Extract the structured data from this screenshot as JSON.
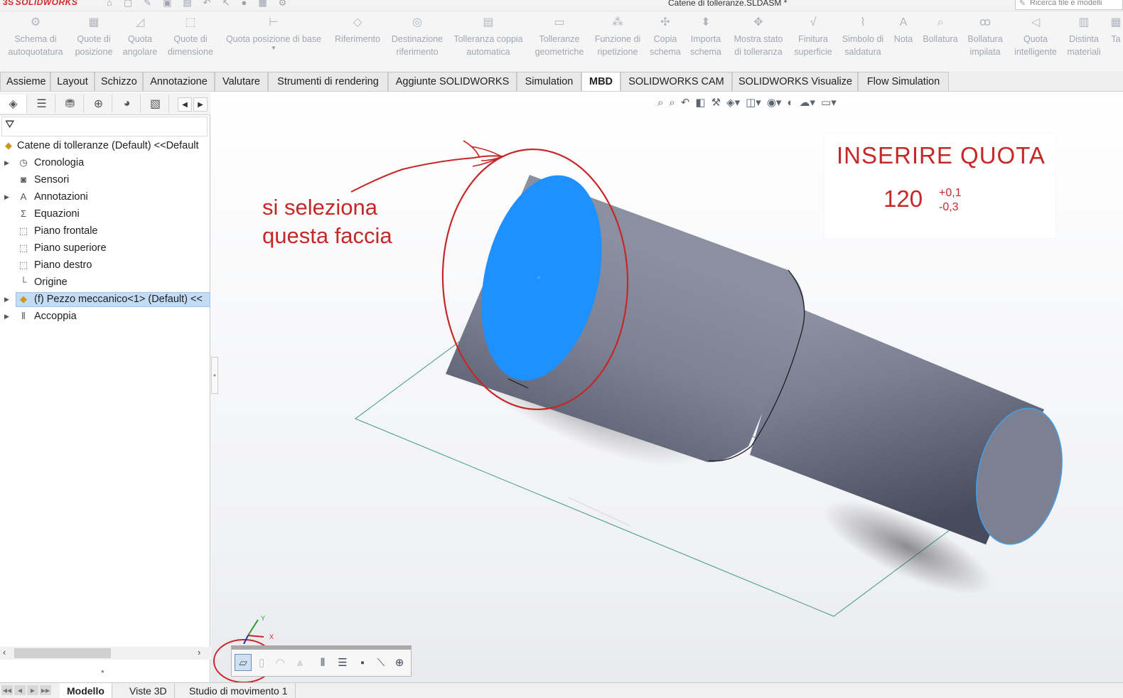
{
  "app": {
    "logo_text": "SOLIDWORKS",
    "document_title": "Catene di tolleranze.SLDASM *",
    "search_placeholder": "Ricerca file e modelli"
  },
  "ribbon": {
    "buttons": [
      {
        "line1": "Schema di",
        "line2": "autoquotatura",
        "icon": "autodimension-scheme-icon"
      },
      {
        "line1": "Quote di",
        "line2": "posizione",
        "icon": "location-dimension-icon"
      },
      {
        "line1": "Quota",
        "line2": "angolare",
        "icon": "angle-dimension-icon"
      },
      {
        "line1": "Quote di",
        "line2": "dimensione",
        "icon": "size-dimension-icon"
      },
      {
        "line1": "Quota posizione di base",
        "line2": "",
        "icon": "basic-location-dimension-icon"
      },
      {
        "line1": "Riferimento",
        "line2": "",
        "icon": "datum-icon"
      },
      {
        "line1": "Destinazione",
        "line2": "riferimento",
        "icon": "datum-target-icon"
      },
      {
        "line1": "Tolleranza coppia",
        "line2": "automatica",
        "icon": "auto-pair-tolerance-icon"
      },
      {
        "line1": "Tolleranze",
        "line2": "geometriche",
        "icon": "geometric-tolerance-icon"
      },
      {
        "line1": "Funzione di",
        "line2": "ripetizione",
        "icon": "pattern-feature-icon"
      },
      {
        "line1": "Copia",
        "line2": "schema",
        "icon": "copy-scheme-icon"
      },
      {
        "line1": "Importa",
        "line2": "schema",
        "icon": "import-scheme-icon"
      },
      {
        "line1": "Mostra stato",
        "line2": "di tolleranza",
        "icon": "tolerance-status-icon"
      },
      {
        "line1": "Finitura",
        "line2": "superficie",
        "icon": "surface-finish-icon"
      },
      {
        "line1": "Simbolo di",
        "line2": "saldatura",
        "icon": "weld-symbol-icon"
      },
      {
        "line1": "Nota",
        "line2": "",
        "icon": "note-icon"
      },
      {
        "line1": "Bollatura",
        "line2": "",
        "icon": "balloon-icon"
      },
      {
        "line1": "Bollatura",
        "line2": "impilata",
        "icon": "stacked-balloon-icon"
      },
      {
        "line1": "Quota",
        "line2": "intelligente",
        "icon": "smart-dimension-icon"
      },
      {
        "line1": "Distinta",
        "line2": "materiali",
        "icon": "bill-of-materials-icon"
      },
      {
        "line1": "Ta",
        "line2": "",
        "icon": "table-icon"
      }
    ]
  },
  "tabs": [
    {
      "label": "Assieme"
    },
    {
      "label": "Layout"
    },
    {
      "label": "Schizzo"
    },
    {
      "label": "Annotazione"
    },
    {
      "label": "Valutare"
    },
    {
      "label": "Strumenti di rendering"
    },
    {
      "label": "Aggiunte SOLIDWORKS"
    },
    {
      "label": "Simulation"
    },
    {
      "label": "MBD"
    },
    {
      "label": "SOLIDWORKS CAM"
    },
    {
      "label": "SOLIDWORKS Visualize"
    },
    {
      "label": "Flow Simulation"
    }
  ],
  "active_tab": "MBD",
  "feature_tree": {
    "root": "Catene di tolleranze (Default) <<Default",
    "items": [
      {
        "label": "Cronologia",
        "icon": "history-icon",
        "expandable": true
      },
      {
        "label": "Sensori",
        "icon": "sensor-icon",
        "expandable": false
      },
      {
        "label": "Annotazioni",
        "icon": "annotations-icon",
        "expandable": true
      },
      {
        "label": "Equazioni",
        "icon": "equations-icon",
        "expandable": false
      },
      {
        "label": "Piano frontale",
        "icon": "plane-icon",
        "expandable": false
      },
      {
        "label": "Piano superiore",
        "icon": "plane-icon",
        "expandable": false
      },
      {
        "label": "Piano destro",
        "icon": "plane-icon",
        "expandable": false
      },
      {
        "label": "Origine",
        "icon": "origin-icon",
        "expandable": false
      },
      {
        "label": "(f) Pezzo meccanico<1> (Default) <<",
        "icon": "part-icon",
        "expandable": true,
        "selected": true
      },
      {
        "label": "Accoppia",
        "icon": "mates-icon",
        "expandable": true
      }
    ]
  },
  "bottom_tabs": [
    {
      "label": "Modello"
    },
    {
      "label": "Viste 3D"
    },
    {
      "label": "Studio di movimento 1"
    }
  ],
  "viewport": {
    "callout_title": "INSERIRE QUOTA",
    "dimension_value": "120",
    "tolerance_upper": "+0,1",
    "tolerance_lower": "-0,3",
    "annotation_line1": "si seleziona",
    "annotation_line2": "questa faccia",
    "triad_y": "Y",
    "triad_x": "X",
    "colors": {
      "selected_face": "#1e90ff",
      "annotation_red": "#c62828",
      "body_gray": "#6d7384",
      "sketch_green": "#2e8b57"
    }
  }
}
